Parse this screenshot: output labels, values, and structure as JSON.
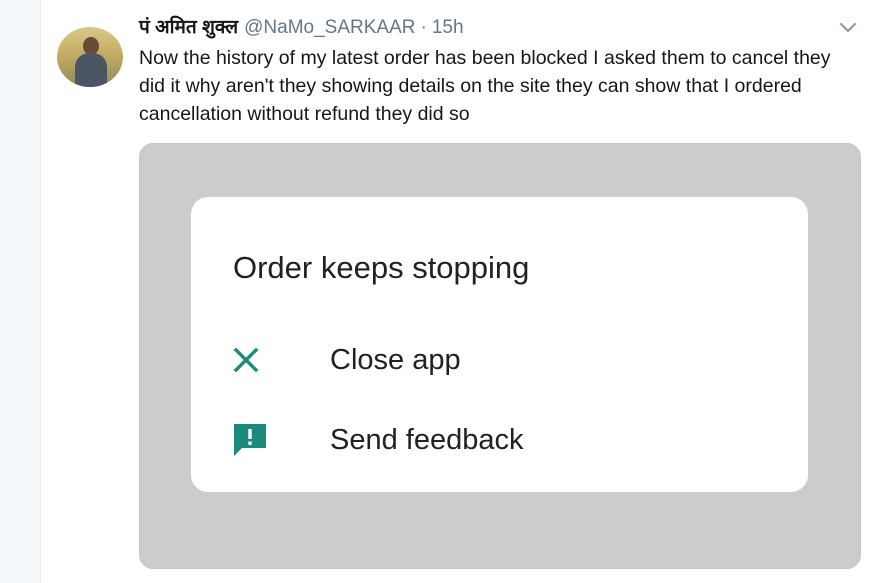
{
  "tweet": {
    "display_name": "पं अमित शुक्ल",
    "handle": "@NaMo_SARKAAR",
    "separator": "·",
    "time": "15h",
    "text": "Now the history of my latest order has been blocked I asked them to cancel they did it why aren't they showing details on the site they can show that I ordered cancellation without refund they did so",
    "avatar_icon": "user-photo-avatar",
    "caret_icon": "chevron-down-icon"
  },
  "dialog": {
    "title": "Order keeps stopping",
    "options": [
      {
        "label": "Close app",
        "icon": "close-icon"
      },
      {
        "label": "Send feedback",
        "icon": "feedback-icon"
      }
    ],
    "accent_color": "#1a8a7d"
  },
  "colors": {
    "text_primary": "#14171a",
    "text_secondary": "#657786",
    "media_background": "#cccccc",
    "dialog_background": "#ffffff"
  }
}
